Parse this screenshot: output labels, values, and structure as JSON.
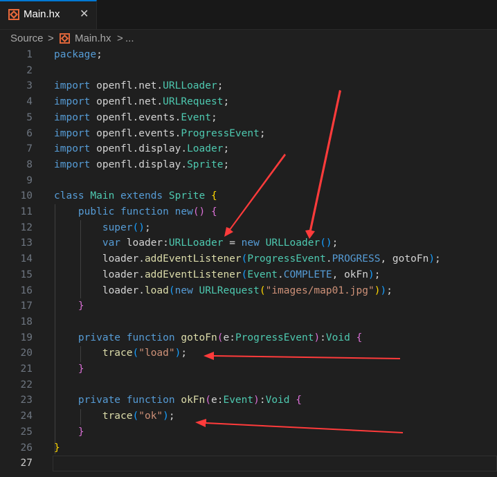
{
  "tab": {
    "title": "Main.hx",
    "close_glyph": "✕",
    "icon": "haxe-icon"
  },
  "breadcrumb": {
    "folder": "Source",
    "sep1": ">",
    "file": "Main.hx",
    "sep2": ">",
    "more": "..."
  },
  "editor": {
    "active_line": 27,
    "lines": [
      {
        "n": "1",
        "t": [
          [
            "kw",
            "package"
          ],
          [
            "pl",
            ";"
          ]
        ]
      },
      {
        "n": "2",
        "t": []
      },
      {
        "n": "3",
        "t": [
          [
            "kw",
            "import"
          ],
          [
            "ns",
            " openfl.net."
          ],
          [
            "ty",
            "URLLoader"
          ],
          [
            "pl",
            ";"
          ]
        ]
      },
      {
        "n": "4",
        "t": [
          [
            "kw",
            "import"
          ],
          [
            "ns",
            " openfl.net."
          ],
          [
            "ty",
            "URLRequest"
          ],
          [
            "pl",
            ";"
          ]
        ]
      },
      {
        "n": "5",
        "t": [
          [
            "kw",
            "import"
          ],
          [
            "ns",
            " openfl.events."
          ],
          [
            "ty",
            "Event"
          ],
          [
            "pl",
            ";"
          ]
        ]
      },
      {
        "n": "6",
        "t": [
          [
            "kw",
            "import"
          ],
          [
            "ns",
            " openfl.events."
          ],
          [
            "ty",
            "ProgressEvent"
          ],
          [
            "pl",
            ";"
          ]
        ]
      },
      {
        "n": "7",
        "t": [
          [
            "kw",
            "import"
          ],
          [
            "ns",
            " openfl.display."
          ],
          [
            "ty",
            "Loader"
          ],
          [
            "pl",
            ";"
          ]
        ]
      },
      {
        "n": "8",
        "t": [
          [
            "kw",
            "import"
          ],
          [
            "ns",
            " openfl.display."
          ],
          [
            "ty",
            "Sprite"
          ],
          [
            "pl",
            ";"
          ]
        ]
      },
      {
        "n": "9",
        "t": []
      },
      {
        "n": "10",
        "t": [
          [
            "kw",
            "class"
          ],
          [
            "pl",
            " "
          ],
          [
            "ty",
            "Main"
          ],
          [
            "pl",
            " "
          ],
          [
            "kw",
            "extends"
          ],
          [
            "pl",
            " "
          ],
          [
            "ty",
            "Sprite"
          ],
          [
            "pl",
            " "
          ],
          [
            "p1",
            "{"
          ]
        ]
      },
      {
        "n": "11",
        "t": [
          [
            "pl",
            "    "
          ],
          [
            "kw",
            "public"
          ],
          [
            "pl",
            " "
          ],
          [
            "kw",
            "function"
          ],
          [
            "pl",
            " "
          ],
          [
            "kw",
            "new"
          ],
          [
            "p2",
            "()"
          ],
          [
            "pl",
            " "
          ],
          [
            "p2",
            "{"
          ]
        ]
      },
      {
        "n": "12",
        "t": [
          [
            "pl",
            "        "
          ],
          [
            "kw",
            "super"
          ],
          [
            "p3",
            "()"
          ],
          [
            "pl",
            ";"
          ]
        ]
      },
      {
        "n": "13",
        "t": [
          [
            "pl",
            "        "
          ],
          [
            "kw",
            "var"
          ],
          [
            "pl",
            " "
          ],
          [
            "ns",
            "loader:"
          ],
          [
            "ty",
            "URLLoader"
          ],
          [
            "pl",
            " = "
          ],
          [
            "kw",
            "new"
          ],
          [
            "pl",
            " "
          ],
          [
            "ty",
            "URLLoader"
          ],
          [
            "p3",
            "()"
          ],
          [
            "pl",
            ";"
          ]
        ]
      },
      {
        "n": "14",
        "t": [
          [
            "pl",
            "        "
          ],
          [
            "ns",
            "loader."
          ],
          [
            "fn",
            "addEventListener"
          ],
          [
            "p3",
            "("
          ],
          [
            "ty",
            "ProgressEvent"
          ],
          [
            "pl",
            "."
          ],
          [
            "kw",
            "PROGRESS"
          ],
          [
            "pl",
            ", "
          ],
          [
            "ns",
            "gotoFn"
          ],
          [
            "p3",
            ")"
          ],
          [
            "pl",
            ";"
          ]
        ]
      },
      {
        "n": "15",
        "t": [
          [
            "pl",
            "        "
          ],
          [
            "ns",
            "loader."
          ],
          [
            "fn",
            "addEventListener"
          ],
          [
            "p3",
            "("
          ],
          [
            "ty",
            "Event"
          ],
          [
            "pl",
            "."
          ],
          [
            "kw",
            "COMPLETE"
          ],
          [
            "pl",
            ", "
          ],
          [
            "ns",
            "okFn"
          ],
          [
            "p3",
            ")"
          ],
          [
            "pl",
            ";"
          ]
        ]
      },
      {
        "n": "16",
        "t": [
          [
            "pl",
            "        "
          ],
          [
            "ns",
            "loader."
          ],
          [
            "fn",
            "load"
          ],
          [
            "p3",
            "("
          ],
          [
            "kw",
            "new"
          ],
          [
            "pl",
            " "
          ],
          [
            "ty",
            "URLRequest"
          ],
          [
            "p1",
            "("
          ],
          [
            "str",
            "\"images/map01.jpg\""
          ],
          [
            "p1",
            ")"
          ],
          [
            "p3",
            ")"
          ],
          [
            "pl",
            ";"
          ]
        ]
      },
      {
        "n": "17",
        "t": [
          [
            "pl",
            "    "
          ],
          [
            "p2",
            "}"
          ]
        ]
      },
      {
        "n": "18",
        "t": []
      },
      {
        "n": "19",
        "t": [
          [
            "pl",
            "    "
          ],
          [
            "kw",
            "private"
          ],
          [
            "pl",
            " "
          ],
          [
            "kw",
            "function"
          ],
          [
            "pl",
            " "
          ],
          [
            "fn",
            "gotoFn"
          ],
          [
            "p2",
            "("
          ],
          [
            "ns",
            "e:"
          ],
          [
            "ty",
            "ProgressEvent"
          ],
          [
            "p2",
            ")"
          ],
          [
            "pl",
            ":"
          ],
          [
            "ty",
            "Void"
          ],
          [
            "pl",
            " "
          ],
          [
            "p2",
            "{"
          ]
        ]
      },
      {
        "n": "20",
        "t": [
          [
            "pl",
            "        "
          ],
          [
            "fn",
            "trace"
          ],
          [
            "p3",
            "("
          ],
          [
            "str",
            "\"load\""
          ],
          [
            "p3",
            ")"
          ],
          [
            "pl",
            ";"
          ]
        ]
      },
      {
        "n": "21",
        "t": [
          [
            "pl",
            "    "
          ],
          [
            "p2",
            "}"
          ]
        ]
      },
      {
        "n": "22",
        "t": []
      },
      {
        "n": "23",
        "t": [
          [
            "pl",
            "    "
          ],
          [
            "kw",
            "private"
          ],
          [
            "pl",
            " "
          ],
          [
            "kw",
            "function"
          ],
          [
            "pl",
            " "
          ],
          [
            "fn",
            "okFn"
          ],
          [
            "p2",
            "("
          ],
          [
            "ns",
            "e:"
          ],
          [
            "ty",
            "Event"
          ],
          [
            "p2",
            ")"
          ],
          [
            "pl",
            ":"
          ],
          [
            "ty",
            "Void"
          ],
          [
            "pl",
            " "
          ],
          [
            "p2",
            "{"
          ]
        ]
      },
      {
        "n": "24",
        "t": [
          [
            "pl",
            "        "
          ],
          [
            "fn",
            "trace"
          ],
          [
            "p3",
            "("
          ],
          [
            "str",
            "\"ok\""
          ],
          [
            "p3",
            ")"
          ],
          [
            "pl",
            ";"
          ]
        ]
      },
      {
        "n": "25",
        "t": [
          [
            "pl",
            "    "
          ],
          [
            "p2",
            "}"
          ]
        ]
      },
      {
        "n": "26",
        "t": [
          [
            "p1",
            "}"
          ]
        ]
      },
      {
        "n": "27",
        "t": []
      }
    ]
  },
  "annotations": {
    "arrow_color": "#ff3b3b"
  }
}
